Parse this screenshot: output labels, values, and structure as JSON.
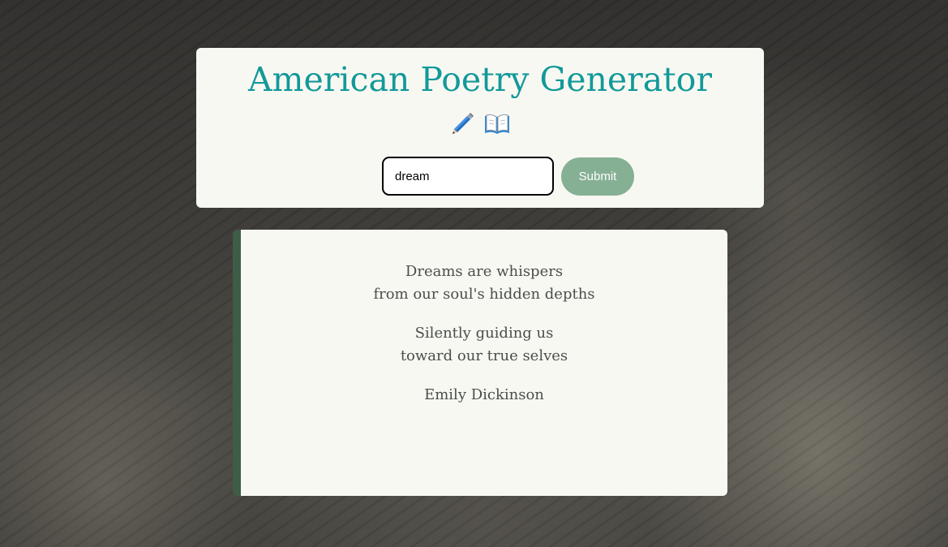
{
  "header": {
    "title": "American Poetry Generator",
    "icons": [
      "pencil-icon",
      "open-book-icon"
    ],
    "title_color": "#12999a"
  },
  "form": {
    "input_value": "dream",
    "submit_label": "Submit",
    "submit_color": "#85b094"
  },
  "poem": {
    "stanzas": [
      {
        "lines": [
          "Dreams are whispers",
          "from our soul's hidden depths"
        ]
      },
      {
        "lines": [
          "Silently guiding us",
          "toward our true selves"
        ]
      }
    ],
    "author": "Emily Dickinson",
    "accent_color": "#3f5c47"
  }
}
